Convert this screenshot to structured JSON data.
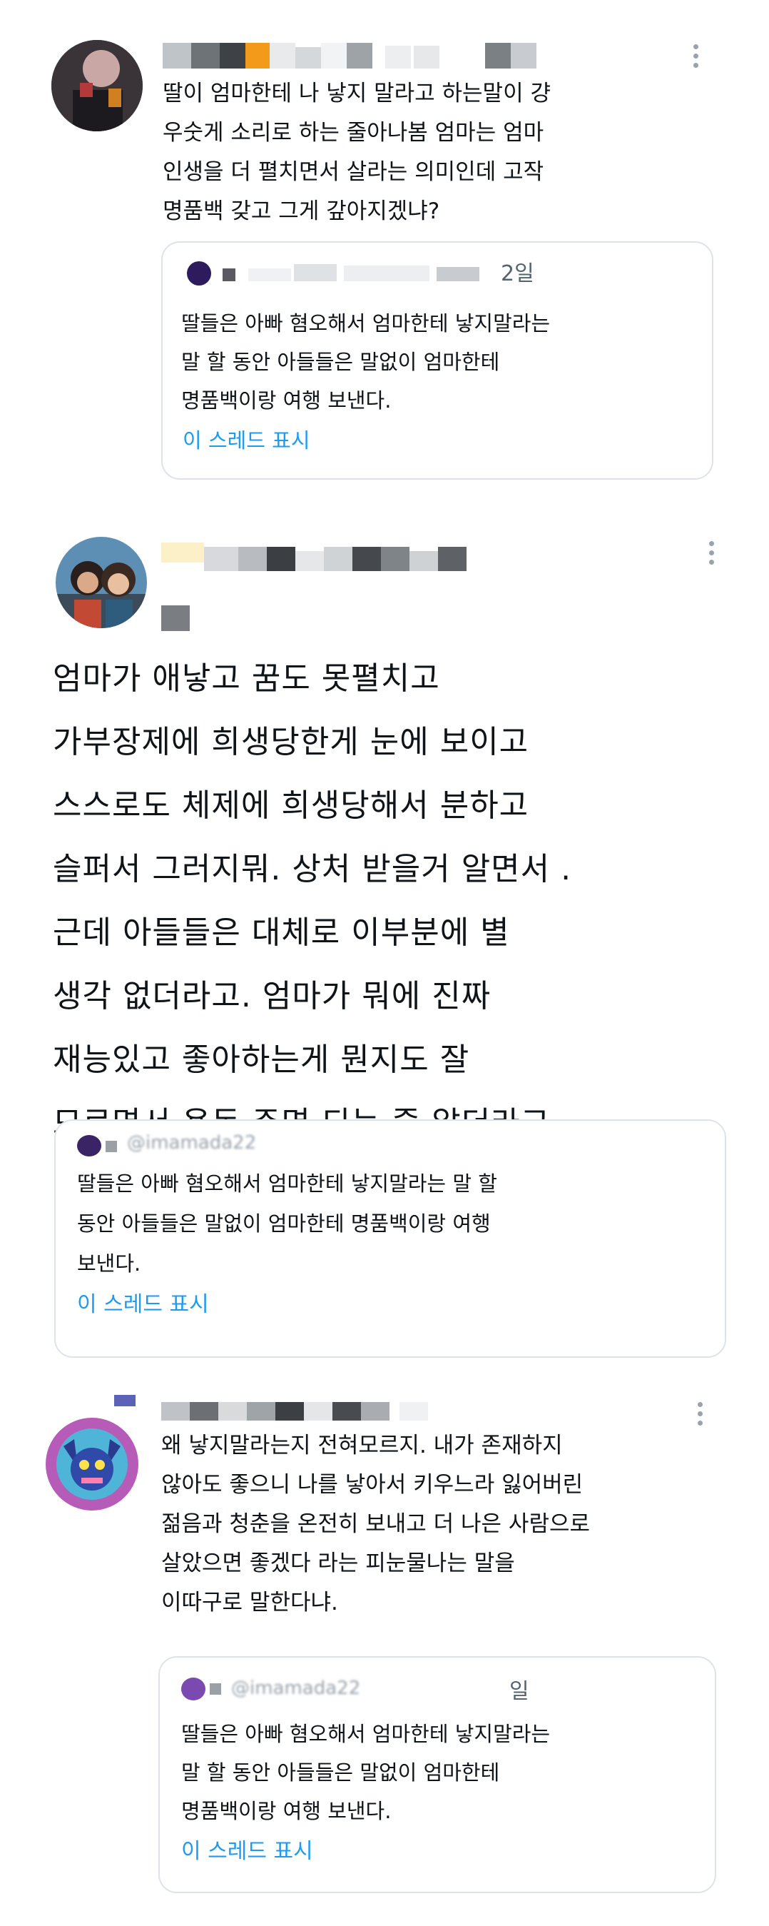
{
  "tweets": [
    {
      "body": "딸이 엄마한테 나 낳지 말라고 하는말이 걍\n우숫게 소리로 하는 줄아나봄 엄마는 엄마\n인생을 더 펼치면서 살라는 의미인데 고작\n명품백 갖고 그게 갚아지겠냐?",
      "quote": {
        "date_suffix": "2일",
        "text": "딸들은 아빠 혐오해서 엄마한테 낳지말라는\n말 할 동안 아들들은 말없이 엄마한테\n명품백이랑 여행 보낸다.",
        "show_thread": "이 스레드 표시"
      }
    },
    {
      "body": "엄마가 애낳고 꿈도 못펼치고\n가부장제에 희생당한게 눈에 보이고\n스스로도 체제에 희생당해서 분하고\n슬퍼서 그러지뭐. 상처 받을거 알면서 .\n근데 아들들은 대체로 이부분에 별\n생각 없더라고. 엄마가 뭐에 진짜\n재능있고 좋아하는게 뭔지도 잘\n모르면서 용돈 주면 되는 줄 알더라고.",
      "quote": {
        "handle": "@imamada22",
        "text": "딸들은 아빠 혐오해서 엄마한테 낳지말라는 말 할\n동안 아들들은 말없이 엄마한테 명품백이랑 여행\n보낸다.",
        "show_thread": "이 스레드 표시"
      }
    },
    {
      "body": "왜 낳지말라는지 전혀모르지. 내가 존재하지\n않아도 좋으니 나를 낳아서 키우느라 잃어버린\n젊음과 청춘을 온전히 보내고 더 나은 사람으로\n살았으면 좋겠다 라는 피눈물나는 말을\n이따구로 말한다냐.",
      "quote": {
        "handle": "@imamada22",
        "date_suffix": "일",
        "text": "딸들은 아빠 혐오해서 엄마한테 낳지말라는\n말 할 동안 아들들은 말없이 엄마한테\n명품백이랑 여행 보낸다.",
        "show_thread": "이 스레드 표시"
      }
    }
  ],
  "colors": {
    "link": "#1d9bf0",
    "text": "#0f1419",
    "border": "#dde3e8"
  },
  "icons": {
    "more": "more-options-icon"
  }
}
